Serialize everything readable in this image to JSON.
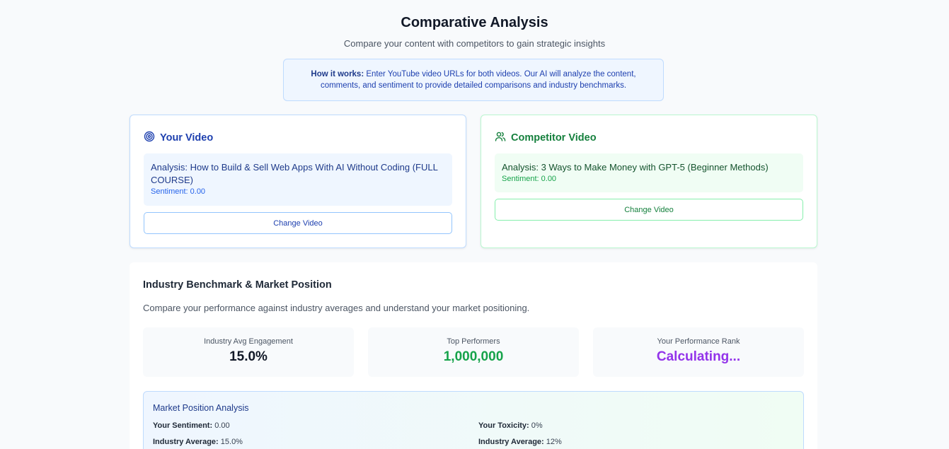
{
  "header": {
    "title": "Comparative Analysis",
    "subtitle": "Compare your content with competitors to gain strategic insights"
  },
  "info": {
    "label": "How it works:",
    "text": " Enter YouTube video URLs for both videos. Our AI will analyze the content, comments, and sentiment to provide detailed comparisons and industry benchmarks."
  },
  "your_video": {
    "heading": "Your Video",
    "icon": "target-icon",
    "analysis_title": "Analysis: How to Build & Sell Web Apps With AI Without Coding (FULL COURSE)",
    "sentiment": "Sentiment: 0.00",
    "button": "Change Video"
  },
  "competitor_video": {
    "heading": "Competitor Video",
    "icon": "users-icon",
    "analysis_title": "Analysis: 3 Ways to Make Money with GPT-5 (Beginner Methods)",
    "sentiment": "Sentiment: 0.00",
    "button": "Change Video"
  },
  "benchmark": {
    "title": "Industry Benchmark & Market Position",
    "description": "Compare your performance against industry averages and understand your market positioning.",
    "metrics": [
      {
        "label": "Industry Avg Engagement",
        "value": "15.0%"
      },
      {
        "label": "Top Performers",
        "value": "1,000,000"
      },
      {
        "label": "Your Performance Rank",
        "value": "Calculating..."
      }
    ],
    "market": {
      "title": "Market Position Analysis",
      "left": [
        {
          "label": "Your Sentiment:",
          "value": " 0.00"
        },
        {
          "label": "Industry Average:",
          "value": " 15.0%"
        }
      ],
      "right": [
        {
          "label": "Your Toxicity:",
          "value": " 0%"
        },
        {
          "label": "Industry Average:",
          "value": " 12%"
        }
      ]
    }
  },
  "colors": {
    "blue_accent": "#1e40af",
    "green_accent": "#15803d",
    "purple_accent": "#9333ea"
  }
}
